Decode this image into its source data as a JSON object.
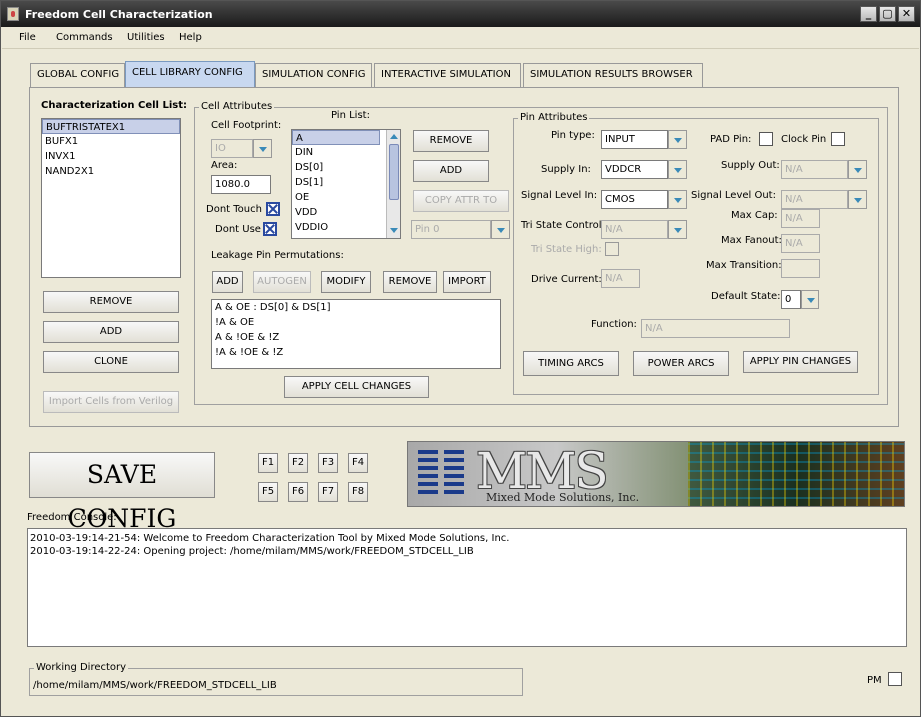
{
  "window": {
    "title": "Freedom Cell Characterization",
    "minimize": "_",
    "maximize": "▢",
    "close": "✕"
  },
  "menu": [
    "File",
    "Commands",
    "Utilities",
    "Help"
  ],
  "tabs": [
    "GLOBAL CONFIG",
    "CELL LIBRARY CONFIG",
    "SIMULATION CONFIG",
    "INTERACTIVE SIMULATION",
    "SIMULATION RESULTS BROWSER"
  ],
  "active_tab": "CELL LIBRARY CONFIG",
  "cell_list": {
    "label": "Characterization Cell List:",
    "items": [
      "BUFTRISTATEX1",
      "BUFX1",
      "INVX1",
      "NAND2X1"
    ],
    "selected": "BUFTRISTATEX1",
    "remove": "REMOVE",
    "add": "ADD",
    "clone": "CLONE",
    "import": "Import Cells from Verilog"
  },
  "cell_attributes": {
    "title": "Cell Attributes",
    "footprint_label": "Cell Footprint:",
    "footprint_value": "IO",
    "area_label": "Area:",
    "area_value": "1080.0",
    "dont_touch_label": "Dont Touch",
    "dont_use_label": "Dont Use",
    "pin_list_label": "Pin List:",
    "pins": [
      "A",
      "DIN",
      "DS[0]",
      "DS[1]",
      "OE",
      "VDD",
      "VDDIO"
    ],
    "selected_pin": "A",
    "pin_remove": "REMOVE",
    "pin_add": "ADD",
    "copy_attr": "COPY ATTR TO",
    "copy_target": "Pin 0",
    "leakage_label": "Leakage Pin Permutations:",
    "leak_add": "ADD",
    "leak_autogen": "AUTOGEN",
    "leak_modify": "MODIFY",
    "leak_remove": "REMOVE",
    "leak_import": "IMPORT",
    "leakage_items": [
      "A & OE : DS[0] & DS[1]",
      "!A & OE",
      "A & !OE & !Z",
      "!A & !OE & !Z"
    ],
    "apply": "APPLY CELL CHANGES"
  },
  "pin_attributes": {
    "title": "Pin Attributes",
    "pin_type_label": "Pin type:",
    "pin_type": "INPUT",
    "pad_pin_label": "PAD Pin:",
    "clock_pin_label": "Clock Pin",
    "supply_in_label": "Supply In:",
    "supply_in": "VDDCR",
    "supply_out_label": "Supply Out:",
    "supply_out": "N/A",
    "signal_in_label": "Signal Level In:",
    "signal_in": "CMOS",
    "signal_out_label": "Signal Level Out:",
    "signal_out": "N/A",
    "tri_control_label": "Tri State Control:",
    "tri_control": "N/A",
    "max_cap_label": "Max Cap:",
    "max_cap": "N/A",
    "tri_high_label": "Tri State High:",
    "max_fanout_label": "Max Fanout:",
    "max_fanout": "N/A",
    "drive_current_label": "Drive Current:",
    "drive_current": "N/A",
    "max_transition_label": "Max Transition:",
    "max_transition": "",
    "default_state_label": "Default State:",
    "default_state": "0",
    "function_label": "Function:",
    "function": "N/A",
    "timing_arcs": "TIMING ARCS",
    "power_arcs": "POWER ARCS",
    "apply_pin": "APPLY PIN CHANGES"
  },
  "save_config": "SAVE CONFIG",
  "fkeys": [
    "F1",
    "F2",
    "F3",
    "F4",
    "F5",
    "F6",
    "F7",
    "F8"
  ],
  "logo": {
    "text": "MMS",
    "subtitle": "Mixed Mode Solutions, Inc."
  },
  "console": {
    "label": "Freedom Console:",
    "lines": [
      "2010-03-19:14-21-54:  Welcome to Freedom Characterization Tool by Mixed Mode Solutions, Inc.",
      "2010-03-19:14-22-24:  Opening project: /home/milam/MMS/work/FREEDOM_STDCELL_LIB"
    ]
  },
  "working_dir": {
    "label": "Working Directory",
    "path": "/home/milam/MMS/work/FREEDOM_STDCELL_LIB"
  },
  "pm_label": "PM"
}
